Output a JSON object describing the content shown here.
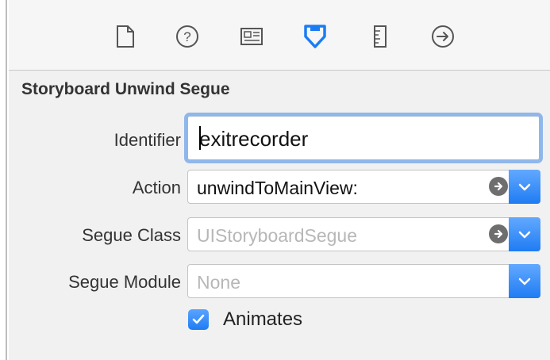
{
  "toolbar": {
    "icons": [
      "file-inspector-icon",
      "quick-help-icon",
      "identity-inspector-icon",
      "attributes-inspector-icon",
      "size-inspector-icon",
      "connections-inspector-icon"
    ],
    "selected": "attributes-inspector-icon",
    "accent": "#1b7cf4"
  },
  "section": {
    "title": "Storyboard Unwind Segue"
  },
  "fields": {
    "identifier": {
      "label": "Identifier",
      "value": "exitrecorder"
    },
    "action": {
      "label": "Action",
      "value": "unwindToMainView:"
    },
    "segue_class": {
      "label": "Segue Class",
      "placeholder": "UIStoryboardSegue"
    },
    "segue_module": {
      "label": "Segue Module",
      "placeholder": "None"
    }
  },
  "animates": {
    "label": "Animates",
    "checked": true
  }
}
